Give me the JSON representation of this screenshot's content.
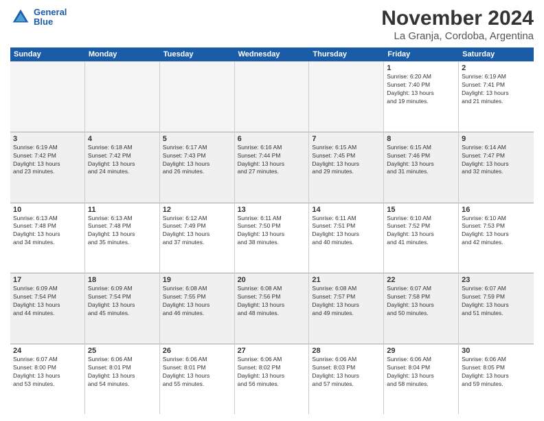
{
  "logo": {
    "line1": "General",
    "line2": "Blue"
  },
  "title": "November 2024",
  "subtitle": "La Granja, Cordoba, Argentina",
  "days": [
    "Sunday",
    "Monday",
    "Tuesday",
    "Wednesday",
    "Thursday",
    "Friday",
    "Saturday"
  ],
  "weeks": [
    [
      {
        "day": "",
        "info": "",
        "empty": true
      },
      {
        "day": "",
        "info": "",
        "empty": true
      },
      {
        "day": "",
        "info": "",
        "empty": true
      },
      {
        "day": "",
        "info": "",
        "empty": true
      },
      {
        "day": "",
        "info": "",
        "empty": true
      },
      {
        "day": "1",
        "info": "Sunrise: 6:20 AM\nSunset: 7:40 PM\nDaylight: 13 hours\nand 19 minutes."
      },
      {
        "day": "2",
        "info": "Sunrise: 6:19 AM\nSunset: 7:41 PM\nDaylight: 13 hours\nand 21 minutes."
      }
    ],
    [
      {
        "day": "3",
        "info": "Sunrise: 6:19 AM\nSunset: 7:42 PM\nDaylight: 13 hours\nand 23 minutes."
      },
      {
        "day": "4",
        "info": "Sunrise: 6:18 AM\nSunset: 7:42 PM\nDaylight: 13 hours\nand 24 minutes."
      },
      {
        "day": "5",
        "info": "Sunrise: 6:17 AM\nSunset: 7:43 PM\nDaylight: 13 hours\nand 26 minutes."
      },
      {
        "day": "6",
        "info": "Sunrise: 6:16 AM\nSunset: 7:44 PM\nDaylight: 13 hours\nand 27 minutes."
      },
      {
        "day": "7",
        "info": "Sunrise: 6:15 AM\nSunset: 7:45 PM\nDaylight: 13 hours\nand 29 minutes."
      },
      {
        "day": "8",
        "info": "Sunrise: 6:15 AM\nSunset: 7:46 PM\nDaylight: 13 hours\nand 31 minutes."
      },
      {
        "day": "9",
        "info": "Sunrise: 6:14 AM\nSunset: 7:47 PM\nDaylight: 13 hours\nand 32 minutes."
      }
    ],
    [
      {
        "day": "10",
        "info": "Sunrise: 6:13 AM\nSunset: 7:48 PM\nDaylight: 13 hours\nand 34 minutes."
      },
      {
        "day": "11",
        "info": "Sunrise: 6:13 AM\nSunset: 7:48 PM\nDaylight: 13 hours\nand 35 minutes."
      },
      {
        "day": "12",
        "info": "Sunrise: 6:12 AM\nSunset: 7:49 PM\nDaylight: 13 hours\nand 37 minutes."
      },
      {
        "day": "13",
        "info": "Sunrise: 6:11 AM\nSunset: 7:50 PM\nDaylight: 13 hours\nand 38 minutes."
      },
      {
        "day": "14",
        "info": "Sunrise: 6:11 AM\nSunset: 7:51 PM\nDaylight: 13 hours\nand 40 minutes."
      },
      {
        "day": "15",
        "info": "Sunrise: 6:10 AM\nSunset: 7:52 PM\nDaylight: 13 hours\nand 41 minutes."
      },
      {
        "day": "16",
        "info": "Sunrise: 6:10 AM\nSunset: 7:53 PM\nDaylight: 13 hours\nand 42 minutes."
      }
    ],
    [
      {
        "day": "17",
        "info": "Sunrise: 6:09 AM\nSunset: 7:54 PM\nDaylight: 13 hours\nand 44 minutes."
      },
      {
        "day": "18",
        "info": "Sunrise: 6:09 AM\nSunset: 7:54 PM\nDaylight: 13 hours\nand 45 minutes."
      },
      {
        "day": "19",
        "info": "Sunrise: 6:08 AM\nSunset: 7:55 PM\nDaylight: 13 hours\nand 46 minutes."
      },
      {
        "day": "20",
        "info": "Sunrise: 6:08 AM\nSunset: 7:56 PM\nDaylight: 13 hours\nand 48 minutes."
      },
      {
        "day": "21",
        "info": "Sunrise: 6:08 AM\nSunset: 7:57 PM\nDaylight: 13 hours\nand 49 minutes."
      },
      {
        "day": "22",
        "info": "Sunrise: 6:07 AM\nSunset: 7:58 PM\nDaylight: 13 hours\nand 50 minutes."
      },
      {
        "day": "23",
        "info": "Sunrise: 6:07 AM\nSunset: 7:59 PM\nDaylight: 13 hours\nand 51 minutes."
      }
    ],
    [
      {
        "day": "24",
        "info": "Sunrise: 6:07 AM\nSunset: 8:00 PM\nDaylight: 13 hours\nand 53 minutes."
      },
      {
        "day": "25",
        "info": "Sunrise: 6:06 AM\nSunset: 8:01 PM\nDaylight: 13 hours\nand 54 minutes."
      },
      {
        "day": "26",
        "info": "Sunrise: 6:06 AM\nSunset: 8:01 PM\nDaylight: 13 hours\nand 55 minutes."
      },
      {
        "day": "27",
        "info": "Sunrise: 6:06 AM\nSunset: 8:02 PM\nDaylight: 13 hours\nand 56 minutes."
      },
      {
        "day": "28",
        "info": "Sunrise: 6:06 AM\nSunset: 8:03 PM\nDaylight: 13 hours\nand 57 minutes."
      },
      {
        "day": "29",
        "info": "Sunrise: 6:06 AM\nSunset: 8:04 PM\nDaylight: 13 hours\nand 58 minutes."
      },
      {
        "day": "30",
        "info": "Sunrise: 6:06 AM\nSunset: 8:05 PM\nDaylight: 13 hours\nand 59 minutes."
      }
    ]
  ]
}
